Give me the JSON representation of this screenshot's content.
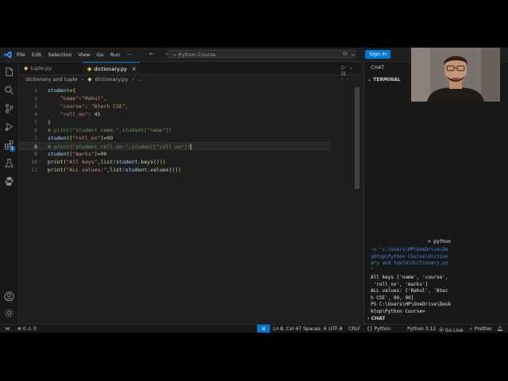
{
  "titlebar": {
    "menu": [
      "File",
      "Edit",
      "Selection",
      "View",
      "Go",
      "Run"
    ],
    "nav_arrows": "←  →",
    "command_center": "Python Course",
    "sign_in": "Sign In"
  },
  "tabs": [
    {
      "label": "tuple.py",
      "active": false
    },
    {
      "label": "dictionary.py",
      "active": true,
      "close": "×"
    }
  ],
  "breadcrumb": {
    "folder": "dictionary and tuple",
    "sep": "›",
    "file": "dictionary.py",
    "more": "..."
  },
  "editor": {
    "line_numbers": [
      "1",
      "2",
      "3",
      "4",
      "5",
      "6",
      "7",
      "8",
      "9",
      "10",
      "11"
    ],
    "current_line": 8
  },
  "panel": {
    "header": "CHAT",
    "terminal_header": "TERMINAL",
    "term_prompt_label": "> python",
    "terminal_lines": [
      "-u \"c:\\Users\\HP\\OneDrive\\De",
      "sktop\\Python Course\\diction",
      "ary and tuple\\dictionary.py",
      "\"",
      "All keys ['name', 'course',",
      " 'roll_no', 'marks']",
      "ALL values: ['Rahul', 'Btec",
      "h CSE', 99, 90]",
      "PS C:\\Users\\HP\\OneDrive\\Desk",
      "ktop\\Python Course> "
    ],
    "chat_footer": "CHAT"
  },
  "statusbar": {
    "errors": "⊗ 0 ⚠ 0",
    "position": "Ln 8, Col 47",
    "spaces": "Spaces: 4",
    "encoding": "UTF-8",
    "eol": "CRLF",
    "language": "{} Python",
    "interpreter": "Python 3.12",
    "golive": "⦿ Go Live",
    "prettier": "✓ Prettier"
  },
  "colors": {
    "accent": "#0078d4",
    "string": "#ce9178",
    "number": "#b5cea8",
    "comment": "#6a9955",
    "function": "#dcdcaa"
  }
}
